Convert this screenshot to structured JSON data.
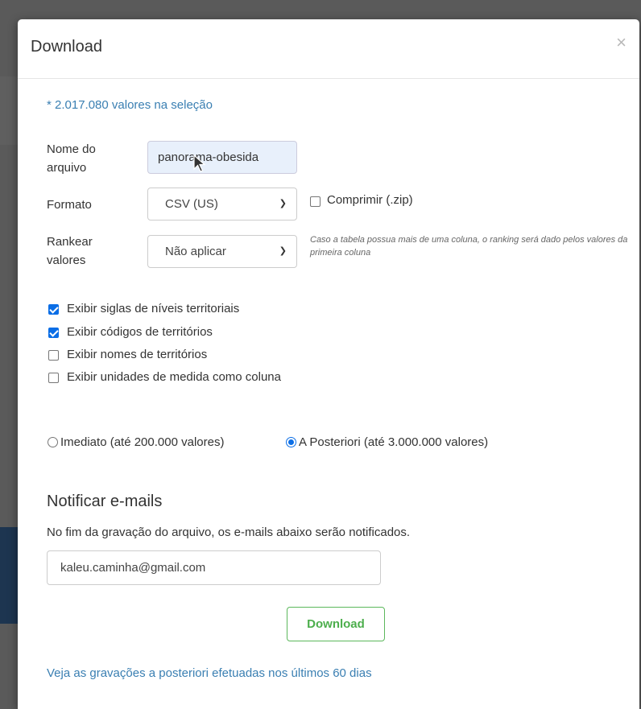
{
  "dialog": {
    "title": "Download",
    "close_glyph": "×"
  },
  "selection_count": "* 2.017.080 valores na seleção",
  "form": {
    "filename_label_line1": "Nome do",
    "filename_label_line2": "arquivo",
    "filename_value": "panorama-obesida",
    "format_label": "Formato",
    "format_selected": "CSV (US)",
    "compress_label": "Comprimir (.zip)",
    "compress_checked": false,
    "rank_label_line1": "Rankear",
    "rank_label_line2": "valores",
    "rank_selected": "Não aplicar",
    "rank_hint": "Caso a tabela possua mais de uma coluna, o ranking será dado pelos valores da primeira coluna"
  },
  "options": [
    {
      "label": "Exibir siglas de níveis territoriais",
      "checked": true
    },
    {
      "label": "Exibir códigos de territórios",
      "checked": true
    },
    {
      "label": "Exibir nomes de territórios",
      "checked": false
    },
    {
      "label": "Exibir unidades de medida como coluna",
      "checked": false
    }
  ],
  "mode": {
    "immediate_label": "Imediato (até 200.000 valores)",
    "deferred_label": "A Posteriori (até 3.000.000 valores)",
    "selected": "deferred"
  },
  "notify": {
    "title": "Notificar e-mails",
    "description": "No fim da gravação do arquivo, os e-mails abaixo serão notificados.",
    "email_value": "kaleu.caminha@gmail.com"
  },
  "download_button": "Download",
  "history_link": "Veja as gravações a posteriori efetuadas nos últimos 60 dias",
  "icons": {
    "chevron": "chevron-down-icon",
    "close": "close-icon",
    "cursor": "mouse-pointer-icon"
  }
}
